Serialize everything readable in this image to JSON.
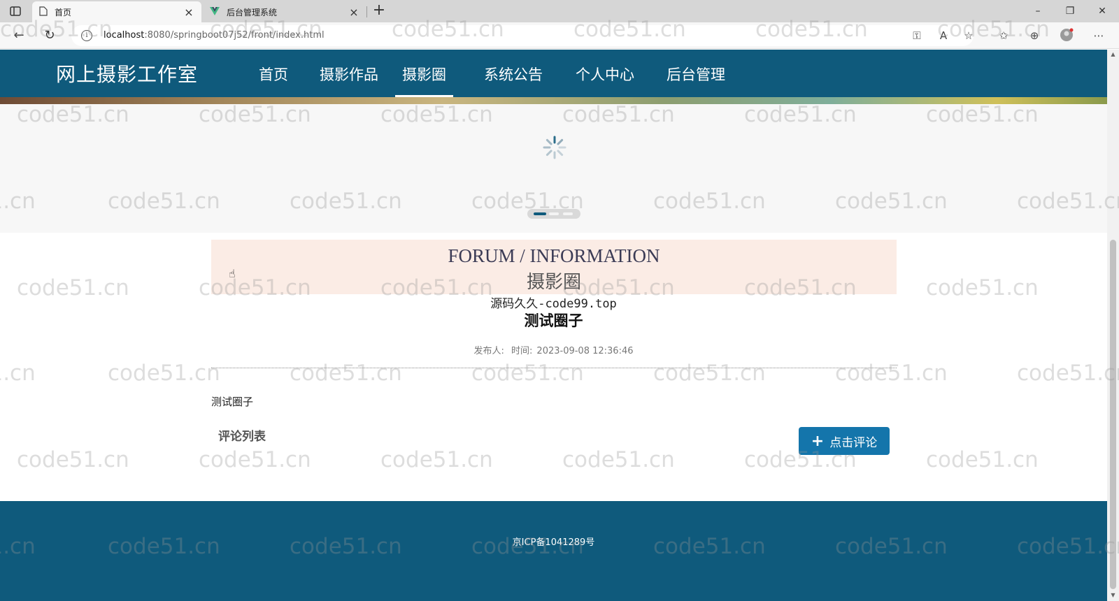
{
  "browser": {
    "tabs": [
      {
        "title": "首页",
        "active": true
      },
      {
        "title": "后台管理系统",
        "active": false
      }
    ],
    "url_host": "localhost",
    "url_rest": ":8080/springboot07j52/front/index.html",
    "icons": [
      "sidebar-icon",
      "page-icon",
      "vue-logo-icon",
      "close-icon",
      "plus-icon",
      "back-icon",
      "reload-icon",
      "info-icon",
      "key-icon",
      "read-aloud-icon",
      "favorite-add-icon",
      "favorites-icon",
      "collections-icon",
      "profile-icon",
      "more-icon"
    ]
  },
  "site": {
    "brand": "网上摄影工作室",
    "nav": [
      {
        "label": "首页",
        "active": false
      },
      {
        "label": "摄影作品",
        "active": false
      },
      {
        "label": "摄影圈",
        "active": true
      },
      {
        "label": "系统公告",
        "active": false
      },
      {
        "label": "个人中心",
        "active": false
      },
      {
        "label": "后台管理",
        "active": false
      }
    ],
    "accent_color": "#0f5a7c"
  },
  "carousel": {
    "slide_count": 3,
    "active_index": 0
  },
  "forum": {
    "heading_en": "FORUM / INFORMATION",
    "heading_cn": "摄影圈"
  },
  "post": {
    "source_line": "源码久久-code99.top",
    "title": "测试圈子",
    "author_label": "发布人:",
    "time_label": "时间:",
    "time_value": "2023-09-08 12:36:46",
    "content": "测试圈子"
  },
  "comments": {
    "heading": "评论列表",
    "add_button": "点击评论"
  },
  "footer": {
    "icp": "京ICP备1041289号"
  },
  "watermark": "code51.cn"
}
